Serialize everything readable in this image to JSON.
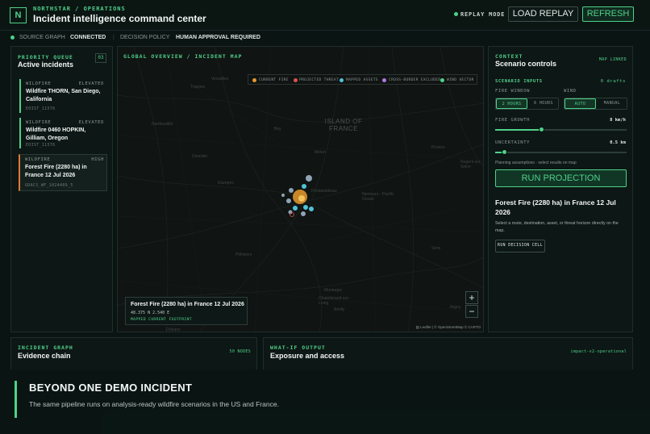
{
  "header": {
    "brand": "NORTHSTAR / OPERATIONS",
    "logo_letter": "N",
    "title": "Incident intelligence command center",
    "replay_mode": "REPLAY MODE",
    "load_replay": "LOAD REPLAY",
    "refresh": "REFRESH"
  },
  "status": {
    "source_graph_label": "SOURCE GRAPH",
    "source_graph_value": "CONNECTED",
    "decision_policy_label": "DECISION POLICY",
    "decision_policy_value": "HUMAN APPROVAL REQUIRED"
  },
  "queue": {
    "kicker": "PRIORITY QUEUE",
    "title": "Active incidents",
    "count": "03",
    "items": [
      {
        "type": "WILDFIRE",
        "level": "ELEVATED",
        "name": "Wildfire THORN, San Diego, California",
        "id": "EOIST_11576"
      },
      {
        "type": "WILDFIRE",
        "level": "ELEVATED",
        "name": "Wildfire 0460 HOPKIN, Gilliam, Oregon",
        "id": "EOIST_11576"
      },
      {
        "type": "WILDFIRE",
        "level": "HIGH",
        "name": "Forest Fire (2280 ha) in France 12 Jul 2026",
        "id": "GDACS_WF_1024409_5"
      }
    ]
  },
  "map": {
    "kicker": "GLOBAL OVERVIEW / INCIDENT MAP",
    "legend": [
      "CURRENT FIRE",
      "PROJECTED THREAT",
      "MAPPED ASSETS",
      "CROSS-BORDER EXCLUDED",
      "WIND VECTOR"
    ],
    "legend_colors": [
      "#e89a2c",
      "#d9534f",
      "#4fc3d8",
      "#b07ae0",
      "#4fd18a"
    ],
    "region_label": "ISLAND OF FRANCE",
    "places": [
      "Versailles",
      "Trappes",
      "Rambouillet",
      "Bey",
      "Dourdan",
      "Etampes",
      "Melun",
      "Fontainebleau",
      "Nemours - Pacific Ocean",
      "Pithiviers",
      "Montargis",
      "Chatellerault-sur-Loing",
      "Amilly",
      "Provins",
      "Nogent-sur-Seine",
      "Sens",
      "Joigny",
      "Orléans"
    ],
    "popup_title": "Forest Fire (2280 ha) in France 12 Jul 2026",
    "popup_coords": "48.375 N 2.540 E",
    "popup_footprint": "MAPPED CURRENT FOOTPRINT",
    "zoom_in": "+",
    "zoom_out": "−",
    "attribution": "▤ Leaflet | © OpenStreetMap © CARTO"
  },
  "context": {
    "kicker": "CONTEXT",
    "title": "Scenario controls",
    "map_linked": "MAP LINKED",
    "inputs_label": "SCENARIO INPUTS",
    "drafts": "0 drafts",
    "fire_window_label": "FIRE WINDOW",
    "fire_window_options": [
      "2 HOURS",
      "6 HOURS"
    ],
    "fire_window_selected": 0,
    "wind_label": "WIND",
    "wind_options": [
      "AUTO",
      "MANUAL"
    ],
    "wind_selected": 0,
    "fire_growth_label": "FIRE GROWTH",
    "fire_growth_value": "8 km/h",
    "fire_growth_fraction": 0.35,
    "uncertainty_label": "UNCERTAINTY",
    "uncertainty_value": "0.5 km",
    "uncertainty_fraction": 0.07,
    "planning_note": "Planning assumptions · select results on map",
    "run_projection": "RUN PROJECTION",
    "selected_title": "Forest Fire (2280 ha) in France 12 Jul 2026",
    "selected_desc": "Select a route, destination, asset, or threat horizon directly on the map.",
    "decision_cell": "RUN DECISION CELL"
  },
  "incident_graph": {
    "kicker": "INCIDENT GRAPH",
    "title": "Evidence chain",
    "tag": "50 NODES"
  },
  "what_if": {
    "kicker": "WHAT-IF OUTPUT",
    "title": "Exposure and access",
    "tag": "impact-v2-operational"
  },
  "overlay": {
    "headline": "BEYOND ONE DEMO INCIDENT",
    "sub": "The same pipeline runs on analysis-ready wildfire scenarios in the US and France."
  }
}
